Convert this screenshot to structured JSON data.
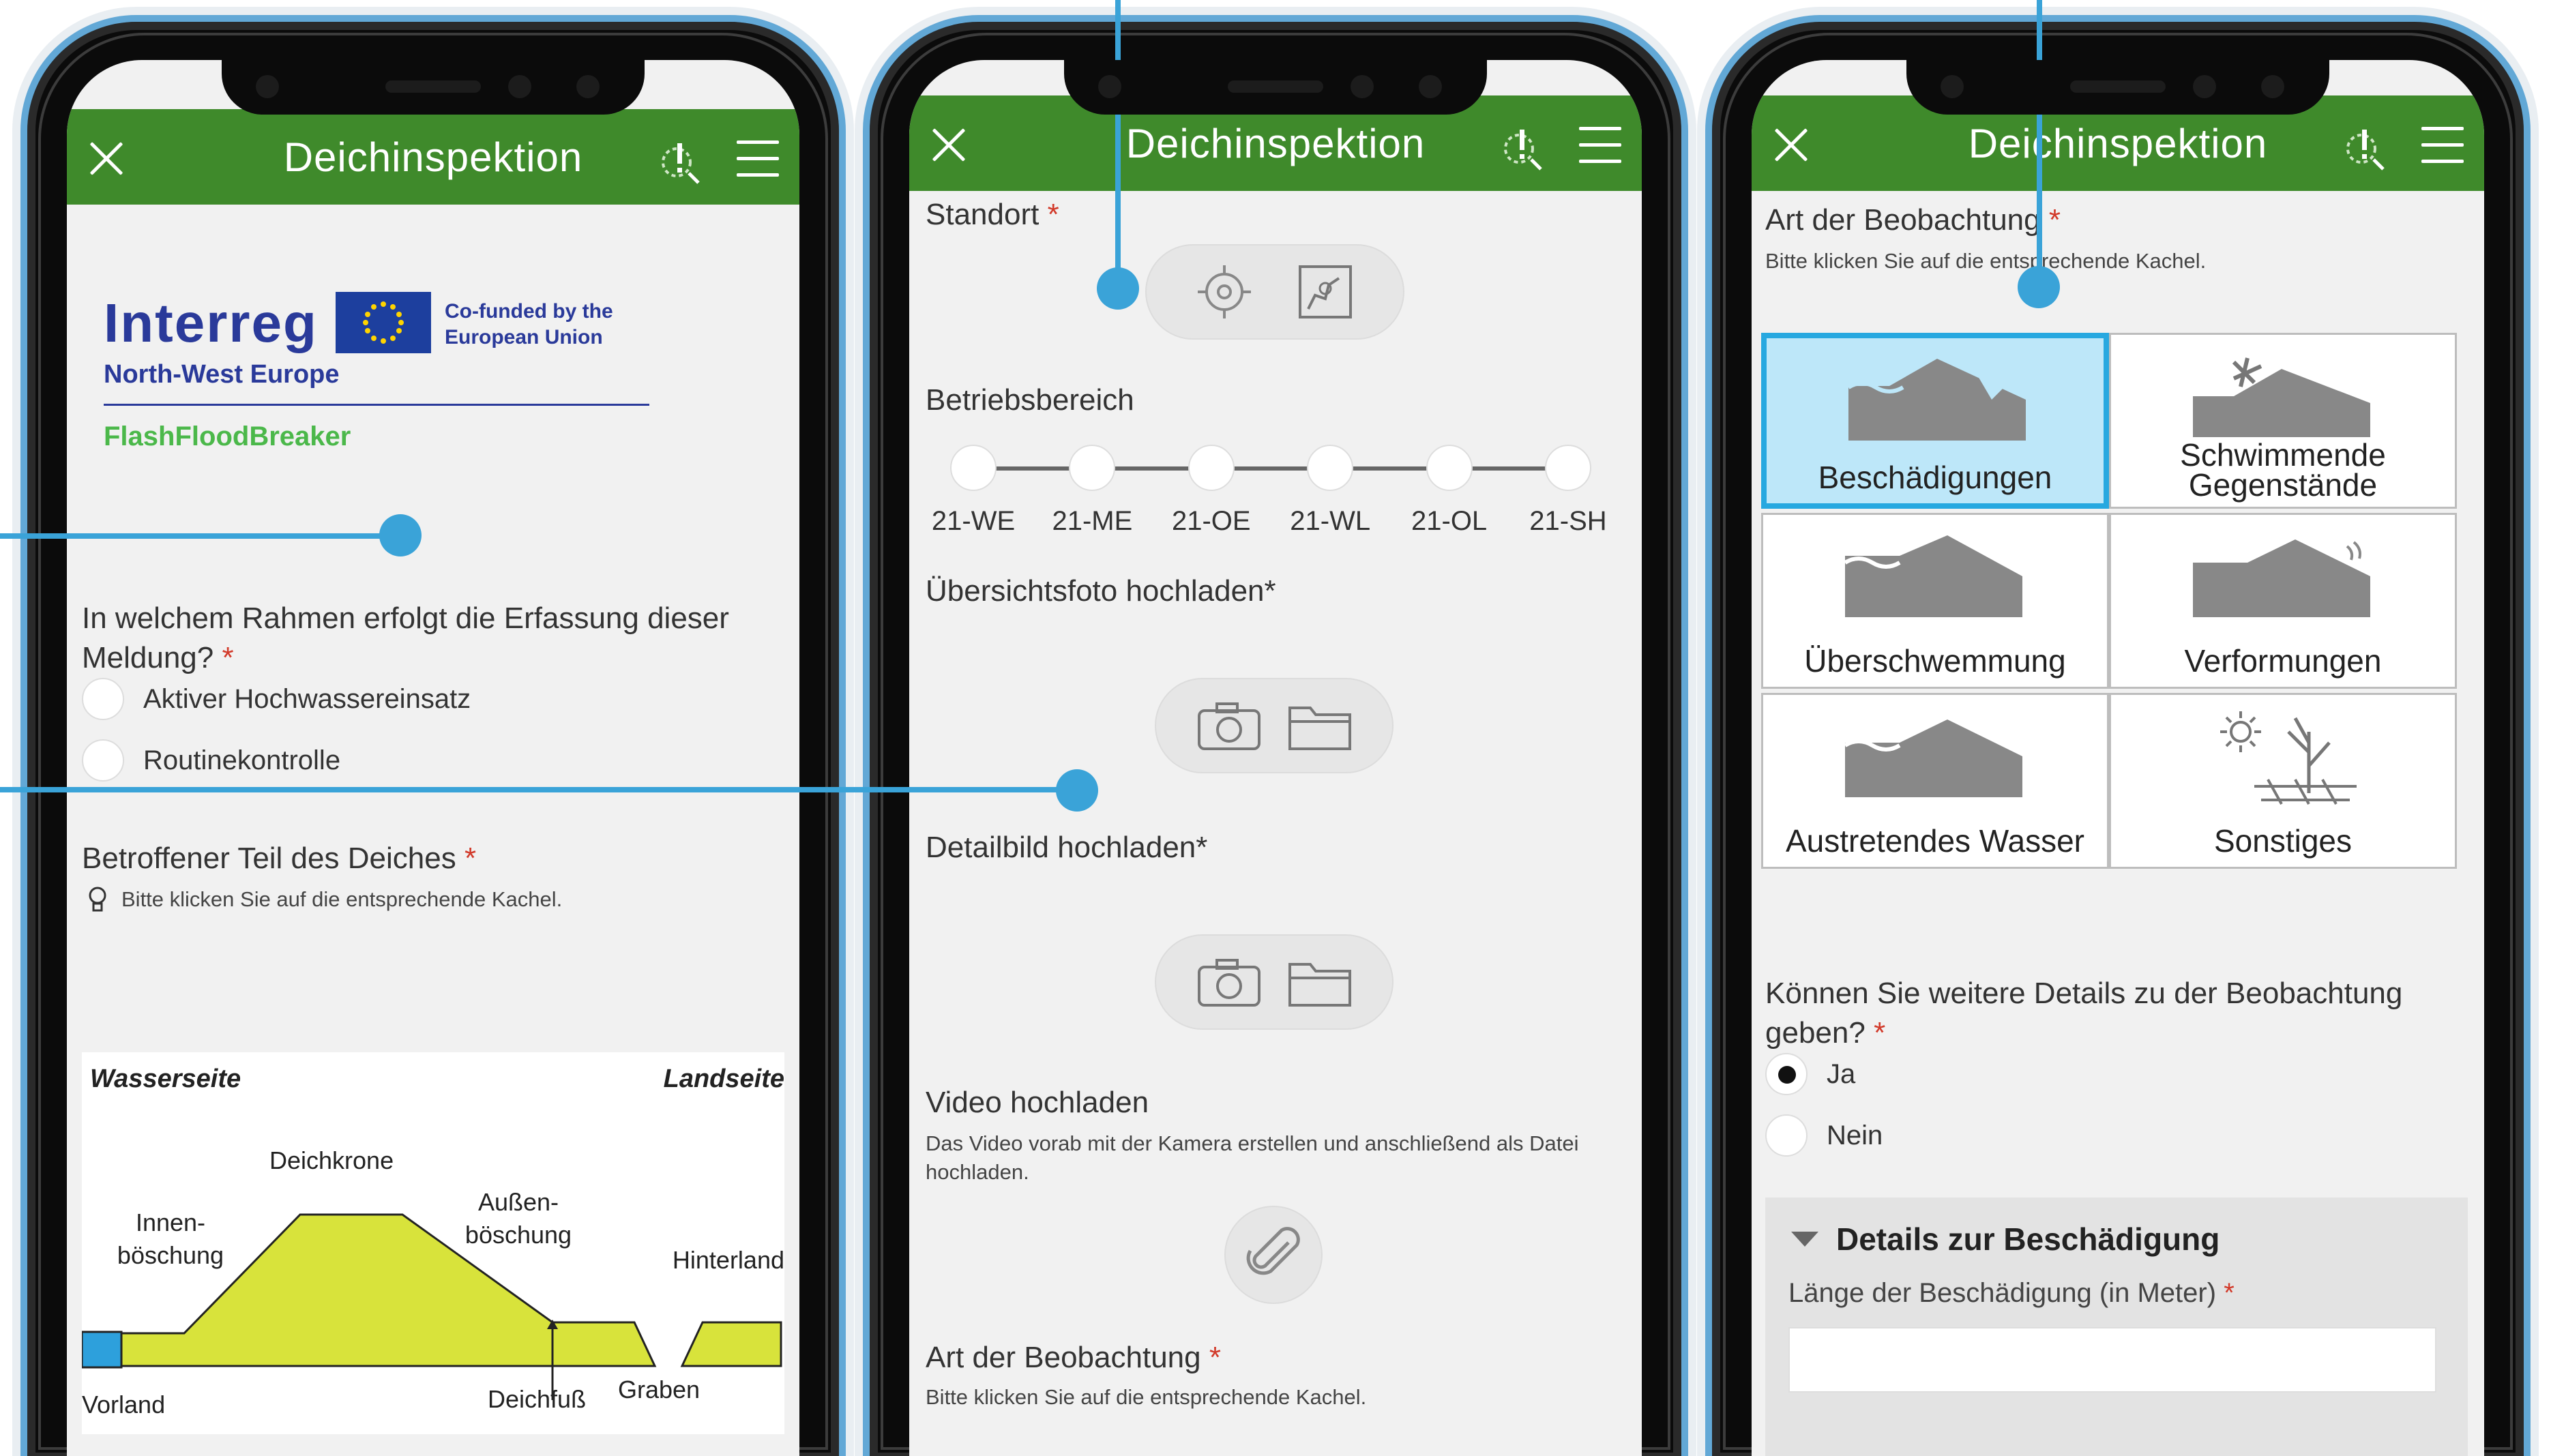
{
  "colors": {
    "header_green": "#3f8a2b",
    "callout_blue": "#3aa3d8",
    "tile_selected": "#bde7f9",
    "required": "#d23a2a"
  },
  "app": {
    "title": "Deichinspektion"
  },
  "screen1": {
    "logo": {
      "program": "Interreg",
      "cofund": "Co-funded by the European Union",
      "region": "North-West Europe",
      "project": "FlashFloodBreaker"
    },
    "question_frame": "In welchem Rahmen erfolgt die Erfassung dieser Meldung?",
    "options": [
      "Aktiver Hochwassereinsatz",
      "Routinekontrolle"
    ],
    "question_part": "Betroffener Teil des Deiches",
    "hint": "Bitte klicken Sie auf die entsprechende Kachel.",
    "diagram": {
      "water_side": "Wasserseite",
      "land_side": "Landseite",
      "crest": "Deichkrone",
      "inner_slope": "Innen-\nböschung",
      "outer_slope": "Außen-\nböschung",
      "hinterland": "Hinterland",
      "foreland": "Vorland",
      "toe": "Deichfuß",
      "ditch": "Graben"
    }
  },
  "screen2": {
    "location_label": "Standort",
    "area_label": "Betriebsbereich",
    "areas": [
      "21-WE",
      "21-ME",
      "21-OE",
      "21-WL",
      "21-OL",
      "21-SH"
    ],
    "overview_photo": "Übersichtsfoto hochladen*",
    "detail_photo": "Detailbild hochladen*",
    "video_label": "Video hochladen",
    "video_hint": "Das Video vorab mit der Kamera erstellen und anschließend als Datei hochladen.",
    "observation_label": "Art der Beobachtung",
    "observation_hint": "Bitte klicken Sie auf die entsprechende Kachel."
  },
  "screen3": {
    "observation_label": "Art der Beobachtung",
    "hint": "Bitte klicken Sie auf die entsprechende Kachel.",
    "tiles": [
      "Beschädigungen",
      "Schwimmende Gegenstände",
      "Überschwemmung",
      "Verformungen",
      "Austretendes Wasser",
      "Sonstiges"
    ],
    "selected_tile": "Beschädigungen",
    "details_question": "Können Sie weitere Details zu der Beobachtung geben?",
    "yes": "Ja",
    "no": "Nein",
    "section_title": "Details zur Beschädigung",
    "length_label": "Länge der Beschädigung (in Meter)"
  }
}
